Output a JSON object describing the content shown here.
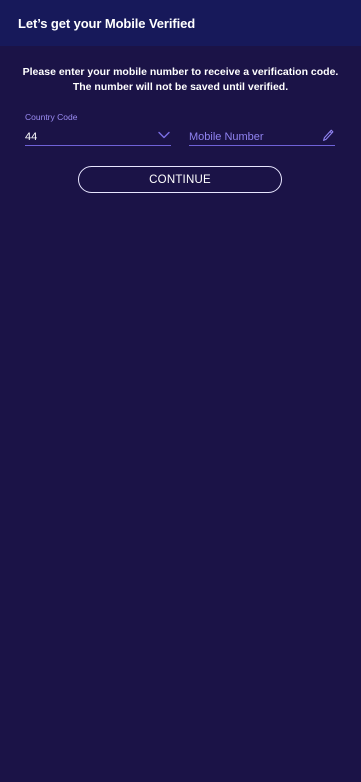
{
  "header": {
    "title": "Let’s get your Mobile Verified"
  },
  "instructions": "Please enter your mobile number to receive a verification code. The number will not be saved until verified.",
  "country_code": {
    "label": "Country Code",
    "value": "44",
    "icon": "chevron-down-icon"
  },
  "mobile_number": {
    "placeholder": "Mobile Number",
    "value": "",
    "icon": "pencil-icon"
  },
  "continue_button": {
    "label": "CONTINUE"
  },
  "colors": {
    "background": "#1b1347",
    "header": "#17195a",
    "accent": "#6f62d8",
    "label": "#9b8cf3"
  }
}
